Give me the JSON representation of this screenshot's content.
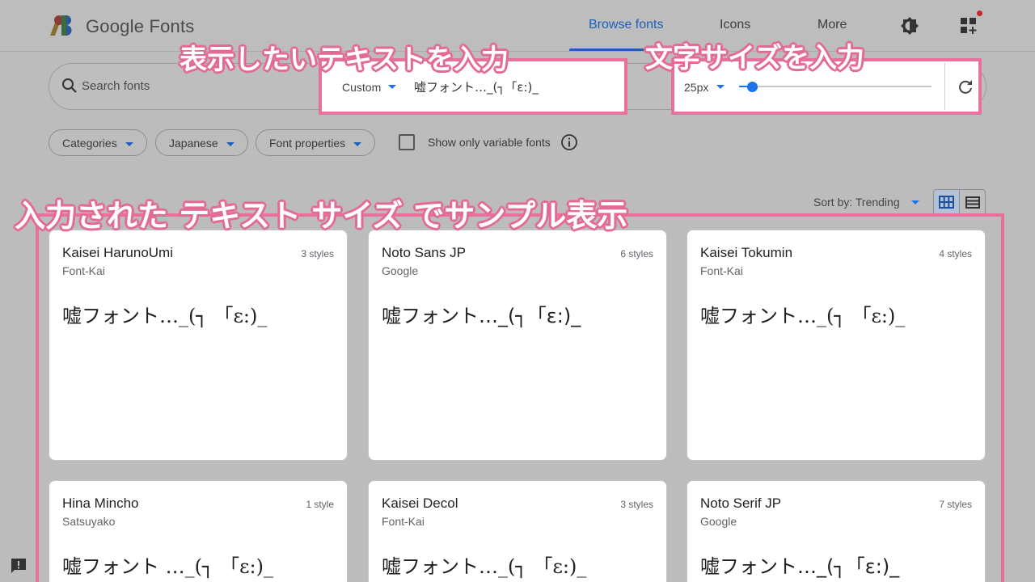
{
  "header": {
    "logo_text": "Google Fonts",
    "nav": [
      "Browse fonts",
      "Icons",
      "More"
    ]
  },
  "search": {
    "placeholder": "Search fonts",
    "sample_mode": "Custom",
    "sample_text": "嘘フォント…_(┐「ε:)_",
    "size_label": "25px",
    "slider_fraction": 0.07
  },
  "filters": {
    "chips": [
      "Categories",
      "Japanese",
      "Font properties"
    ],
    "variable_label": "Show only variable fonts"
  },
  "sort": {
    "label": "Sort by: Trending"
  },
  "callouts": {
    "sample": "表示したいテキストを入力",
    "size": "文字サイズを入力",
    "cards": "入力された テキスト サイズ でサンプル表示"
  },
  "cards": [
    {
      "name": "Kaisei HarunoUmi",
      "foundry": "Font-Kai",
      "styles": "3 styles",
      "sample": "嘘フォント…_(┐ 「ε:)_"
    },
    {
      "name": "Noto Sans JP",
      "foundry": "Google",
      "styles": "6 styles",
      "sample": "嘘フォント…_(┐「ε:)_"
    },
    {
      "name": "Kaisei Tokumin",
      "foundry": "Font-Kai",
      "styles": "4 styles",
      "sample": "嘘フォント…_(┐ 「ε:)_"
    },
    {
      "name": "Hina Mincho",
      "foundry": "Satsuyako",
      "styles": "1 style",
      "sample": "嘘フォント …_(┐ 「ε:)_"
    },
    {
      "name": "Kaisei Decol",
      "foundry": "Font-Kai",
      "styles": "3 styles",
      "sample": "嘘フォント…_(┐ 「ε:)_"
    },
    {
      "name": "Noto Serif JP",
      "foundry": "Google",
      "styles": "7 styles",
      "sample": "嘘フォント…_(┐「ε:)_"
    }
  ],
  "colors": {
    "accent": "#1a73e8",
    "highlight": "#e8709c"
  }
}
